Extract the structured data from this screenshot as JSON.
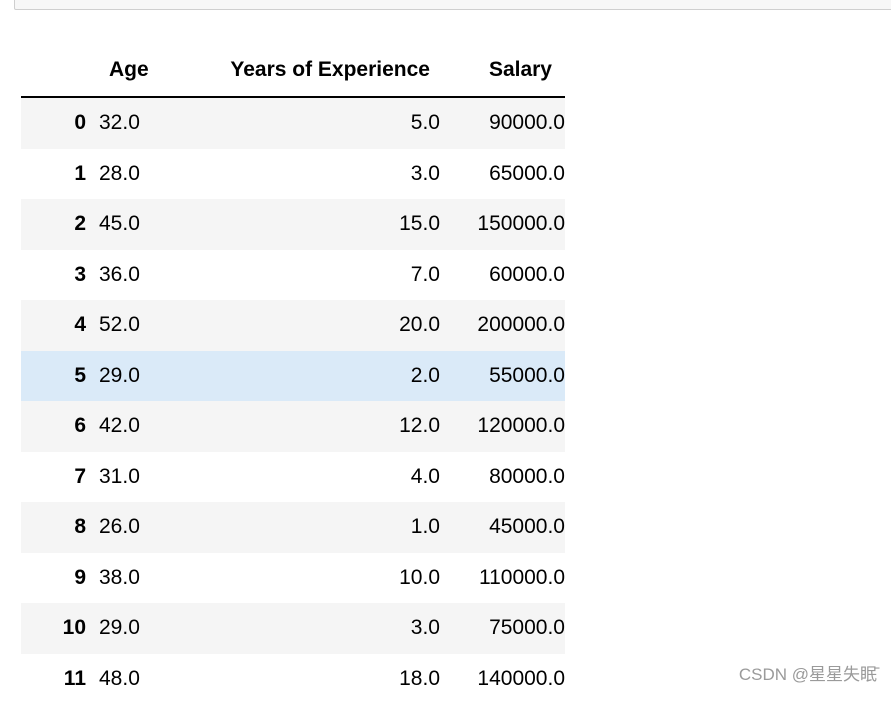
{
  "table": {
    "columns": [
      "",
      "Age",
      "Years of Experience",
      "Salary"
    ],
    "rows": [
      {
        "index": "0",
        "age": "32.0",
        "exp": "5.0",
        "salary": "90000.0"
      },
      {
        "index": "1",
        "age": "28.0",
        "exp": "3.0",
        "salary": "65000.0"
      },
      {
        "index": "2",
        "age": "45.0",
        "exp": "15.0",
        "salary": "150000.0"
      },
      {
        "index": "3",
        "age": "36.0",
        "exp": "7.0",
        "salary": "60000.0"
      },
      {
        "index": "4",
        "age": "52.0",
        "exp": "20.0",
        "salary": "200000.0"
      },
      {
        "index": "5",
        "age": "29.0",
        "exp": "2.0",
        "salary": "55000.0"
      },
      {
        "index": "6",
        "age": "42.0",
        "exp": "12.0",
        "salary": "120000.0"
      },
      {
        "index": "7",
        "age": "31.0",
        "exp": "4.0",
        "salary": "80000.0"
      },
      {
        "index": "8",
        "age": "26.0",
        "exp": "1.0",
        "salary": "45000.0"
      },
      {
        "index": "9",
        "age": "38.0",
        "exp": "10.0",
        "salary": "110000.0"
      },
      {
        "index": "10",
        "age": "29.0",
        "exp": "3.0",
        "salary": "75000.0"
      },
      {
        "index": "11",
        "age": "48.0",
        "exp": "18.0",
        "salary": "140000.0"
      }
    ],
    "hovered_row": 5
  },
  "colors": {
    "stripe": "#f5f5f5",
    "hover": "#daeaf8",
    "header_rule": "#000000"
  },
  "watermark": "CSDN @星星失眠̄"
}
